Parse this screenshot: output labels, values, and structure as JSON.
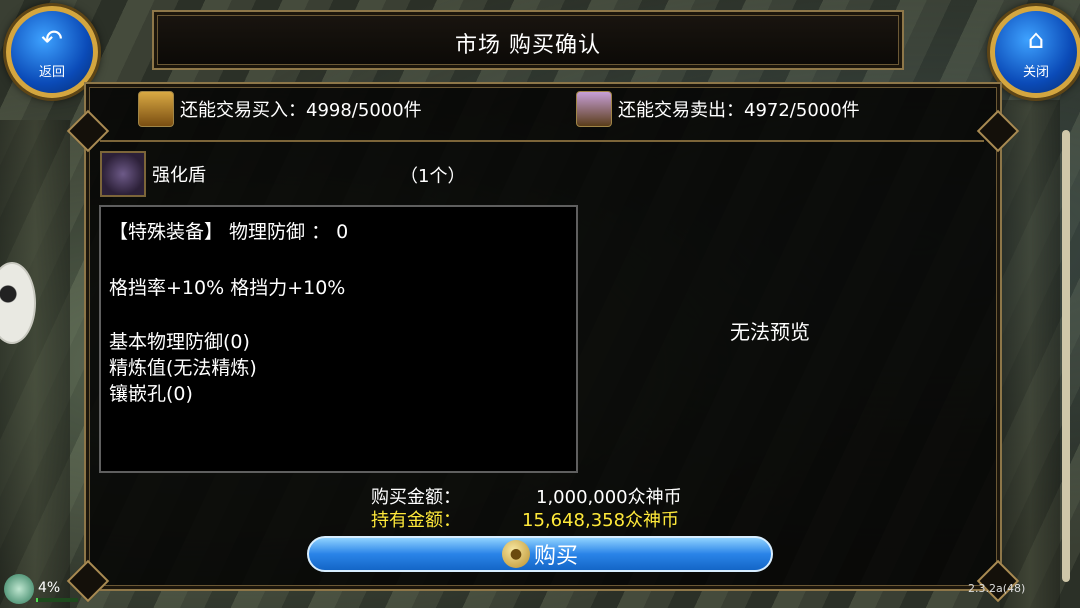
{
  "window_title": "市场 购买确认",
  "back_button": {
    "label": "返回",
    "icon": "back-arrow-icon"
  },
  "close_button": {
    "label": "关闭",
    "icon": "home-icon"
  },
  "trade_limits": {
    "buy_label": "还能交易买入：4998/5000件",
    "sell_label": "还能交易卖出：4972/5000件"
  },
  "item": {
    "name": "强化盾",
    "quantity": "（1个）"
  },
  "description": {
    "line1": "【特殊装备】 物理防御 ：  0",
    "line2": "格挡率+10% 格挡力+10%",
    "line3": "基本物理防御(0)",
    "line4": "精炼值(无法精炼)",
    "line5": "镶嵌孔(0)"
  },
  "preview_text": "无法预览",
  "price": {
    "purchase_label": "购买金额：",
    "purchase_value": "1,000,000众神币",
    "owned_label": "持有金额：",
    "owned_value": "15,648,358众神币"
  },
  "buy_button_label": "购买",
  "status": {
    "percent": "4%",
    "percent_value": 0.04
  },
  "version": "2.3.2a(48)",
  "colors": {
    "gold_text": "#ffe93a",
    "frame": "#8e7749",
    "button": "#2a84e8"
  }
}
